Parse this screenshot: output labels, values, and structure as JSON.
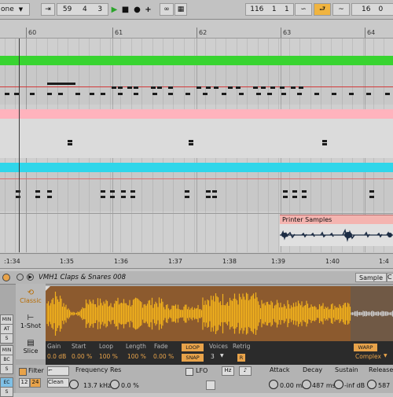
{
  "transport": {
    "mode_label": "one",
    "position": [
      "59",
      "4",
      "3"
    ],
    "loop_position": [
      "116",
      "1",
      "1"
    ],
    "loop_length": "16",
    "loop_length_sub": "0"
  },
  "ruler": {
    "bars": [
      "60",
      "61",
      "62",
      "63",
      "64"
    ]
  },
  "arrangement": {
    "clip_name": "Printer Samples"
  },
  "time_ruler": {
    "labels": [
      ":1:34",
      "1:35",
      "1:36",
      "1:37",
      "1:38",
      "1:39",
      "1:40",
      "1:4"
    ]
  },
  "device": {
    "title": "VMH1 Claps & Snares 008",
    "tab_sample": "Sample",
    "tab_c": "C",
    "modes": {
      "classic": "Classic",
      "one_shot": "1-Shot",
      "slice": "Slice"
    },
    "side_buttons": [
      "MIN",
      "AT",
      "S",
      "MIN",
      "BC",
      "S",
      "EC",
      "S"
    ],
    "params": {
      "gain_label": "Gain",
      "gain_value": "0.0 dB",
      "start_label": "Start",
      "start_value": "0.00 %",
      "loop_label": "Loop",
      "loop_value": "100 %",
      "length_label": "Length",
      "length_value": "100 %",
      "fade_label": "Fade",
      "fade_value": "0.00 %",
      "loop_btn": "LOOP",
      "snap_btn": "SNAP",
      "voices_label": "Voices",
      "voices_value": "3",
      "retrig_label": "Retrig",
      "retrig_value": "R",
      "warp_btn": "WARP",
      "warp_mode": "Complex"
    },
    "bottom": {
      "filter_label": "Filter",
      "filter_num_a": "12",
      "filter_num_b": "24",
      "filter_type": "Clean",
      "frequency_label": "Frequency",
      "frequency_value": "13.7 kHz",
      "res_label": "Res",
      "res_value": "0.0 %",
      "lfo_label": "LFO",
      "hz_label": "Hz",
      "attack_label": "Attack",
      "attack_value": "0.00 ms",
      "decay_label": "Decay",
      "decay_value": "487 ms",
      "sustain_label": "Sustain",
      "sustain_value": "-inf dB",
      "release_label": "Release",
      "release_value": "587"
    }
  },
  "colors": {
    "green_clip": "#38d430",
    "pink_clip": "#ffb3bd",
    "cyan_clip": "#2fd6ea",
    "waveform": "#f3b21c",
    "waveform_bg": "#8c5a2e",
    "accent_orange": "#e8a34a"
  }
}
